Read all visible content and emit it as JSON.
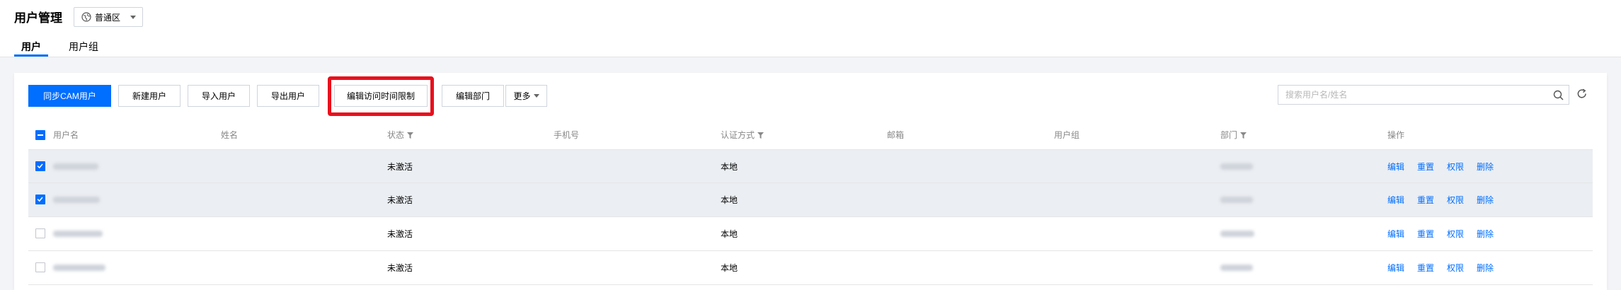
{
  "header": {
    "title": "用户管理",
    "region": "普通区",
    "tabs": [
      {
        "label": "用户",
        "active": true
      },
      {
        "label": "用户组",
        "active": false
      }
    ]
  },
  "toolbar": {
    "sync_cam": "同步CAM用户",
    "new_user": "新建用户",
    "import_user": "导入用户",
    "export_user": "导出用户",
    "edit_access_time": "编辑访问时间限制",
    "edit_department": "编辑部门",
    "more": "更多",
    "search_placeholder": "搜索用户名/姓名",
    "highlighted": "edit_access_time"
  },
  "table": {
    "columns": {
      "username": "用户名",
      "name": "姓名",
      "status": "状态",
      "phone": "手机号",
      "auth": "认证方式",
      "email": "邮箱",
      "group": "用户组",
      "department": "部门",
      "actions": "操作"
    },
    "header_checkbox": "indeterminate",
    "rows": [
      {
        "selected": true,
        "username": "(blurred)",
        "status": "未激活",
        "auth": "本地",
        "department": "(blurred)"
      },
      {
        "selected": true,
        "username": "(blurred)",
        "status": "未激活",
        "auth": "本地",
        "department": "(blurred)"
      },
      {
        "selected": false,
        "username": "(blurred)",
        "status": "未激活",
        "auth": "本地",
        "department": "(blurred)"
      },
      {
        "selected": false,
        "username": "(blurred)",
        "status": "未激活",
        "auth": "本地",
        "department": "(blurred)"
      }
    ],
    "row_actions": {
      "edit": "编辑",
      "reset": "重置",
      "permission": "权限",
      "delete": "删除"
    }
  },
  "colors": {
    "primary": "#006eff",
    "highlight": "#e8101d",
    "selected_row": "#ebeef2"
  }
}
